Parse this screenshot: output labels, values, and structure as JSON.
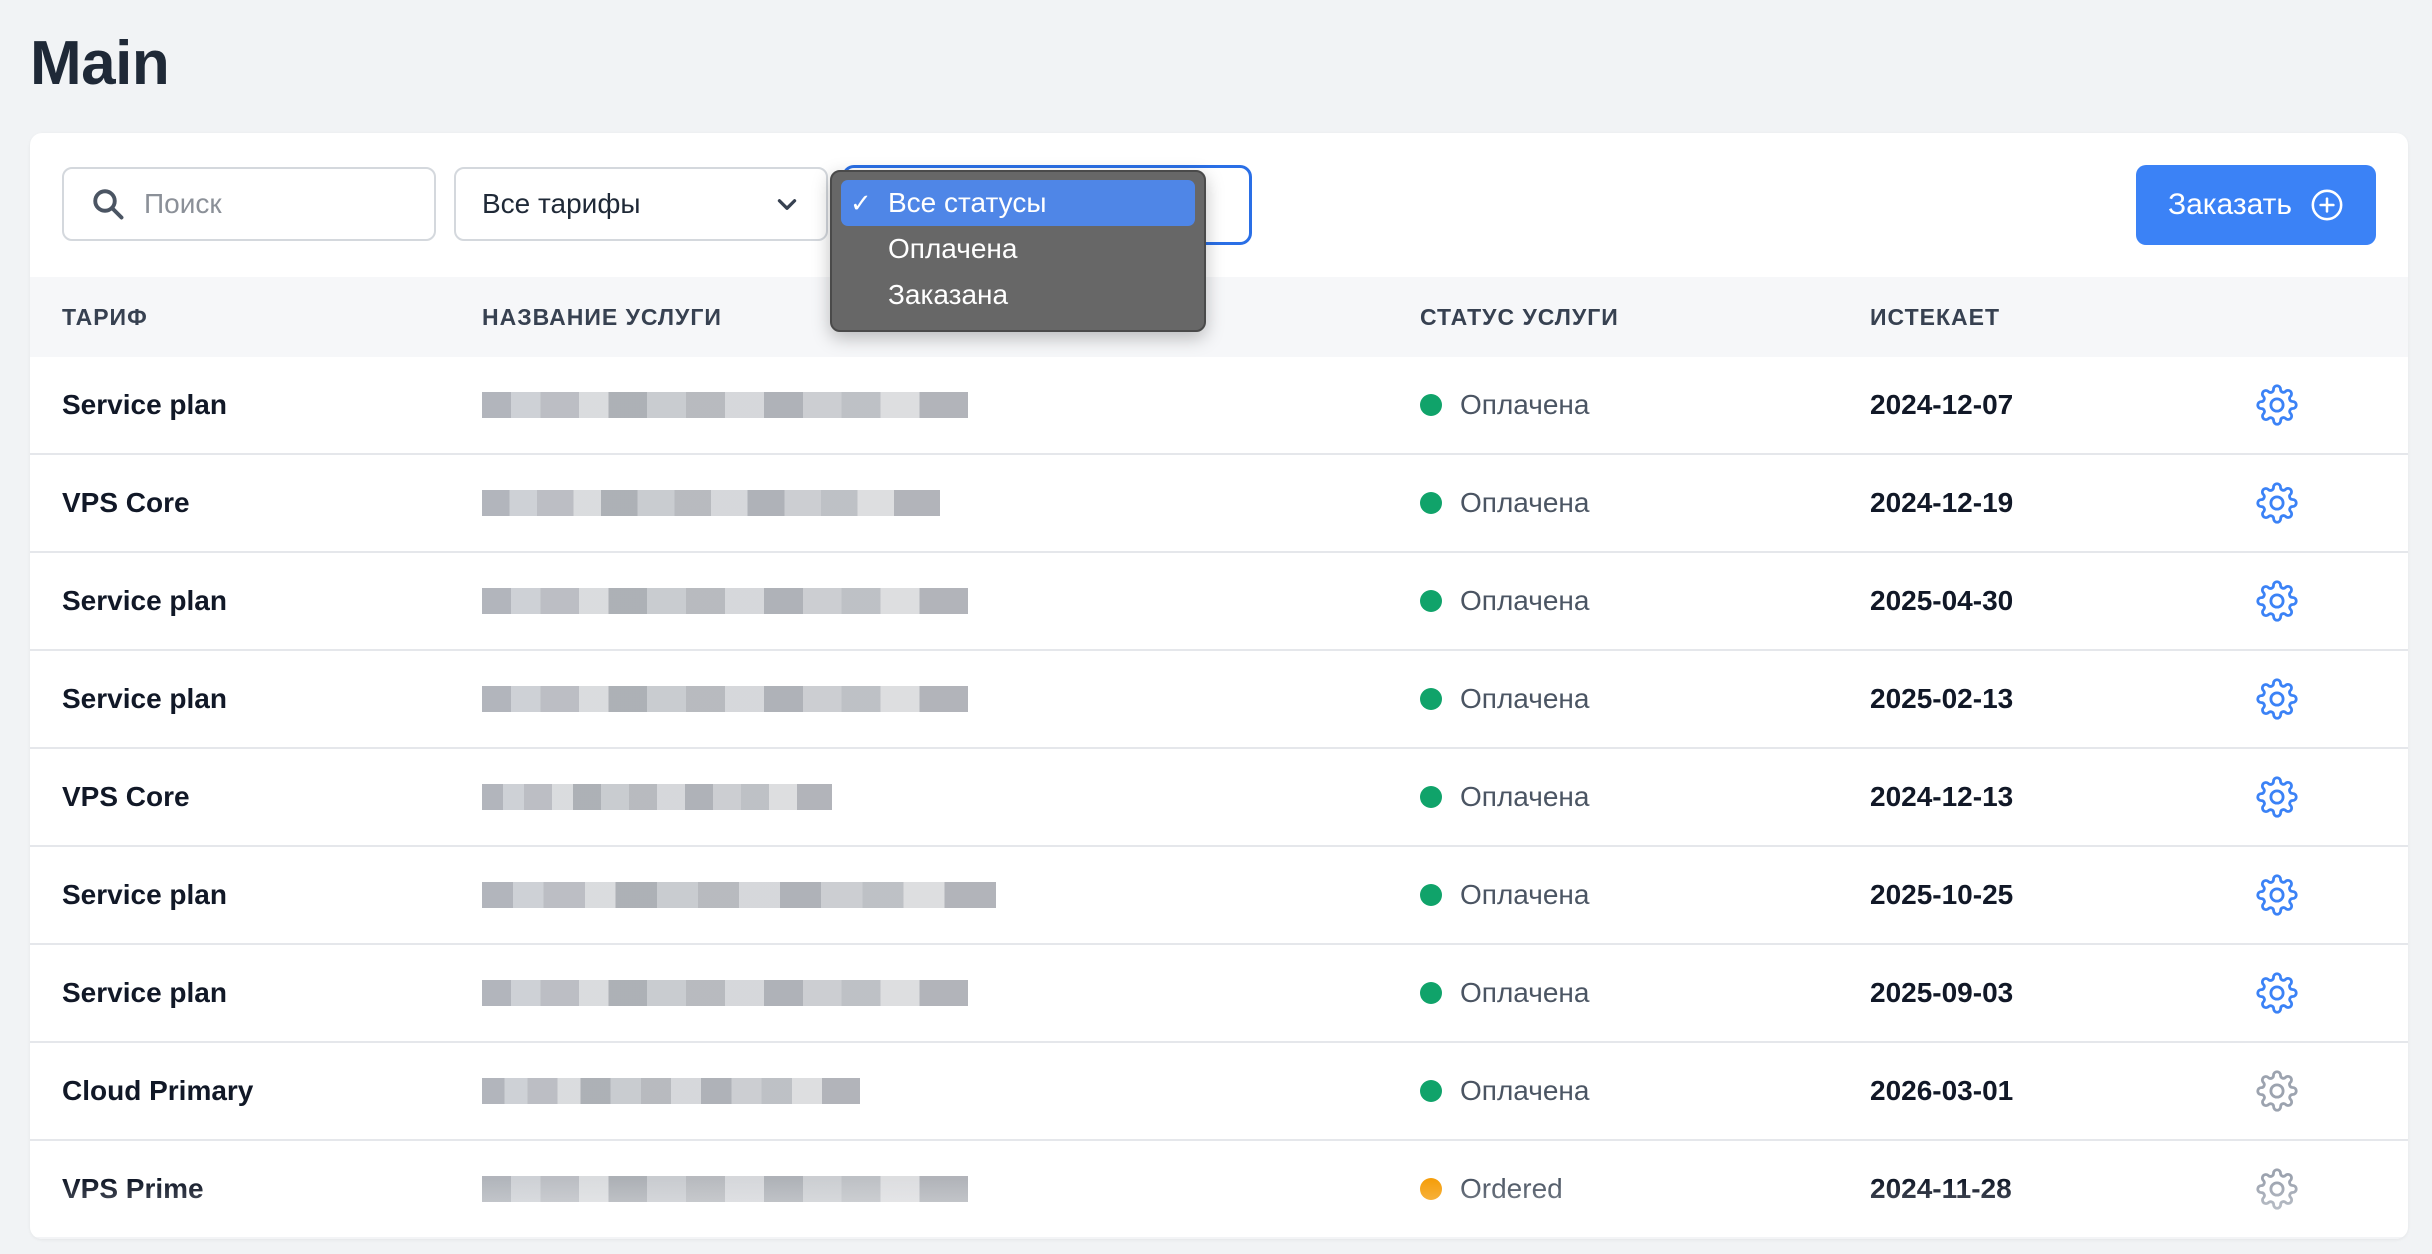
{
  "page": {
    "title": "Main"
  },
  "toolbar": {
    "search_placeholder": "Поиск",
    "plan_select": "Все тарифы",
    "status_options": [
      "Все статусы",
      "Оплачена",
      "Заказана"
    ],
    "status_selected_index": 0,
    "order_button": "Заказать"
  },
  "table": {
    "headers": [
      "ТАРИФ",
      "НАЗВАНИЕ УСЛУГИ",
      "СТАТУС УСЛУГИ",
      "ИСТЕКАЕТ"
    ],
    "rows": [
      {
        "plan": "Service plan",
        "status": "Оплачена",
        "status_color": "#10a36a",
        "expires": "2024-12-07",
        "gear_color": "#3b82f6"
      },
      {
        "plan": "VPS Core",
        "status": "Оплачена",
        "status_color": "#10a36a",
        "expires": "2024-12-19",
        "gear_color": "#3b82f6"
      },
      {
        "plan": "Service plan",
        "status": "Оплачена",
        "status_color": "#10a36a",
        "expires": "2025-04-30",
        "gear_color": "#3b82f6"
      },
      {
        "plan": "Service plan",
        "status": "Оплачена",
        "status_color": "#10a36a",
        "expires": "2025-02-13",
        "gear_color": "#3b82f6"
      },
      {
        "plan": "VPS Core",
        "status": "Оплачена",
        "status_color": "#10a36a",
        "expires": "2024-12-13",
        "gear_color": "#3b82f6"
      },
      {
        "plan": "Service plan",
        "status": "Оплачена",
        "status_color": "#10a36a",
        "expires": "2025-10-25",
        "gear_color": "#3b82f6"
      },
      {
        "plan": "Service plan",
        "status": "Оплачена",
        "status_color": "#10a36a",
        "expires": "2025-09-03",
        "gear_color": "#3b82f6"
      },
      {
        "plan": "Cloud Primary",
        "status": "Оплачена",
        "status_color": "#10a36a",
        "expires": "2026-03-01",
        "gear_color": "#9ca3af"
      },
      {
        "plan": "VPS Prime",
        "status": "Ordered",
        "status_color": "#f59e0b",
        "expires": "2024-11-28",
        "gear_color": "#9ca3af"
      }
    ]
  },
  "colors": {
    "accent": "#3b82f6",
    "paid": "#10a36a",
    "ordered": "#f59e0b"
  }
}
